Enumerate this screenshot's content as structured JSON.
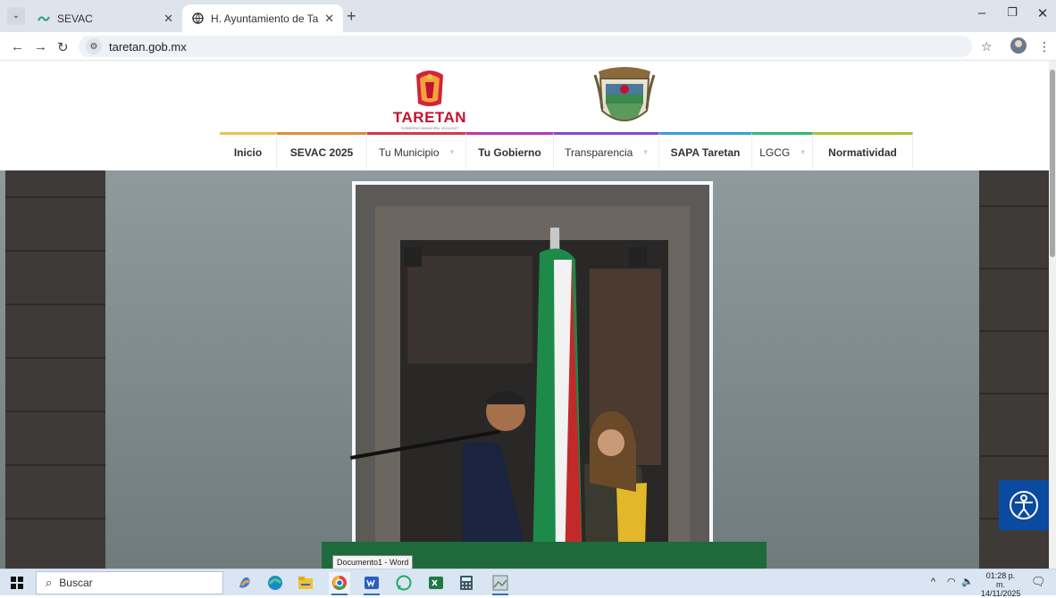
{
  "browser": {
    "tabs": [
      {
        "title": "SEVAC",
        "favicon": "sevac-logo-icon",
        "active": false
      },
      {
        "title": "H. Ayuntamiento de Taretan",
        "favicon": "globe-icon",
        "active": true
      }
    ],
    "url": "taretan.gob.mx"
  },
  "site": {
    "logo_text": "TARETAN",
    "logo_subtitle": "GOBIERNO MUNICIPAL 2024-2027",
    "menu": [
      {
        "label": "Inicio",
        "color": "#e6c44d",
        "dropdown": false,
        "bold": true
      },
      {
        "label": "SEVAC 2025",
        "color": "#e08a3c",
        "dropdown": false,
        "bold": true
      },
      {
        "label": "Tu Municipio",
        "color": "#d23a4c",
        "dropdown": true,
        "bold": false
      },
      {
        "label": "Tu Gobierno",
        "color": "#b33ab0",
        "dropdown": false,
        "bold": true
      },
      {
        "label": "Transparencia",
        "color": "#7b4fc8",
        "dropdown": true,
        "bold": false
      },
      {
        "label": "SAPA Taretan",
        "color": "#3aa0d3",
        "dropdown": false,
        "bold": true
      },
      {
        "label": "LGCG",
        "color": "#3ab37a",
        "dropdown": true,
        "bold": false
      },
      {
        "label": "Normatividad",
        "color": "#a7c43a",
        "dropdown": false,
        "bold": true
      }
    ]
  },
  "taskbar": {
    "search_placeholder": "Buscar",
    "tooltip": "Documento1 - Word",
    "time": "01:28 p. m.",
    "date": "14/11/2025"
  }
}
